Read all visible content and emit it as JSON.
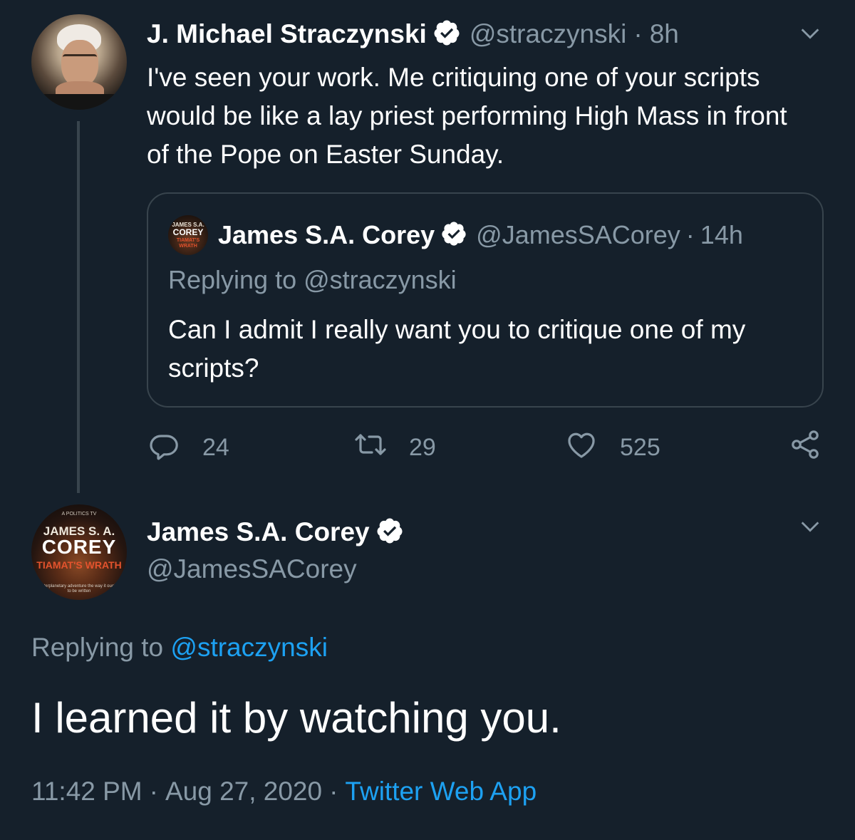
{
  "parent_tweet": {
    "author_name": "J. Michael Straczynski",
    "handle": "@straczynski",
    "separator": "·",
    "time": "8h",
    "text": "I've seen your work. Me critiquing one of your scripts would be like a lay priest performing High Mass in front of the Pope on Easter Sunday.",
    "avatar_icon": "profile-photo",
    "menu_icon": "chevron-down-icon",
    "verified_icon": "verified-badge-icon"
  },
  "quoted_tweet": {
    "author_name": "James S.A. Corey",
    "handle": "@JamesSACorey",
    "separator": "·",
    "time": "14h",
    "replying_to": "Replying to @straczynski",
    "text": "Can I admit I really want you to critique one of my scripts?",
    "avatar_text": {
      "top": "JAMES S.A.",
      "mid": "COREY",
      "bot": "TIAMAT'S WRATH"
    }
  },
  "actions": {
    "reply_count": "24",
    "retweet_count": "29",
    "like_count": "525",
    "icons": [
      "reply-icon",
      "retweet-icon",
      "like-icon",
      "share-icon"
    ]
  },
  "main_tweet": {
    "author_name": "James S.A. Corey",
    "handle": "@JamesSACorey",
    "replying_prefix": "Replying to",
    "replying_handle": "@straczynski",
    "text": "I learned it by watching you.",
    "time": "11:42 PM",
    "separator": "·",
    "date": "Aug 27, 2020",
    "source": "Twitter Web App",
    "avatar_text": {
      "tiny": "A POLITICS TV",
      "top": "JAMES S. A.",
      "mid": "COREY",
      "red": "TIAMAT'S WRATH",
      "small": "interplanetary adventure the way it ought to be written"
    }
  },
  "colors": {
    "background": "#15202b",
    "primary_text": "#ffffff",
    "secondary_text": "#8899a6",
    "link": "#1da1f2",
    "border": "#38444d"
  }
}
